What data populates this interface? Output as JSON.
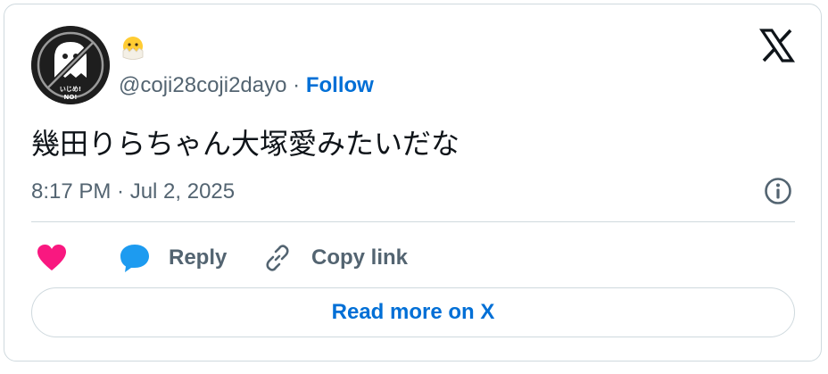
{
  "tweet": {
    "display_name_emoji": "🐣",
    "handle": "@coji28coji2dayo",
    "separator": "·",
    "follow_label": "Follow",
    "text": "幾田りらちゃん大塚愛みたいだな",
    "timestamp": "8:17 PM · Jul 2, 2025",
    "avatar_text_line1": "いじめ!",
    "avatar_text_line2": "NO!"
  },
  "actions": {
    "reply_label": "Reply",
    "copy_link_label": "Copy link",
    "read_more_label": "Read more on X"
  },
  "colors": {
    "link_blue": "#006fd6",
    "heart_pink": "#f91880",
    "reply_blue": "#1d9bf0",
    "secondary_text": "#536471",
    "primary_text": "#0f1419",
    "border": "#cfd9de"
  },
  "icons": {
    "avatar": "ghost-prohibition-avatar",
    "emoji": "hatching-chick-icon",
    "brand": "x-logo-icon",
    "info": "info-icon",
    "like": "heart-icon",
    "reply": "speech-bubble-icon",
    "copy": "link-icon"
  }
}
